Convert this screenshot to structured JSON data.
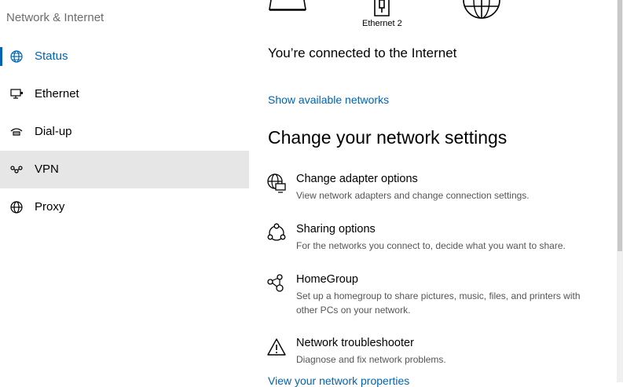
{
  "sidebar": {
    "header": "Network & Internet",
    "items": [
      {
        "label": "Status",
        "icon": "globe-status-icon"
      },
      {
        "label": "Ethernet",
        "icon": "ethernet-icon"
      },
      {
        "label": "Dial-up",
        "icon": "dial-up-icon"
      },
      {
        "label": "VPN",
        "icon": "vpn-icon"
      },
      {
        "label": "Proxy",
        "icon": "globe-icon"
      }
    ]
  },
  "main": {
    "network_label": "Ethernet 2",
    "status_text": "You’re connected to the Internet",
    "show_networks_link": "Show available networks",
    "section_title": "Change your network settings",
    "options": [
      {
        "title": "Change adapter options",
        "desc": "View network adapters and change connection settings.",
        "icon": "adapter-icon"
      },
      {
        "title": "Sharing options",
        "desc": "For the networks you connect to, decide what you want to share.",
        "icon": "sharing-icon"
      },
      {
        "title": "HomeGroup",
        "desc": "Set up a homegroup to share pictures, music, files, and printers with other PCs on your network.",
        "icon": "homegroup-icon"
      },
      {
        "title": "Network troubleshooter",
        "desc": "Diagnose and fix network problems.",
        "icon": "warning-icon"
      }
    ],
    "bottom_link": "View your network properties"
  },
  "colors": {
    "accent": "#0063b1",
    "hover": "#e6e6e6"
  }
}
